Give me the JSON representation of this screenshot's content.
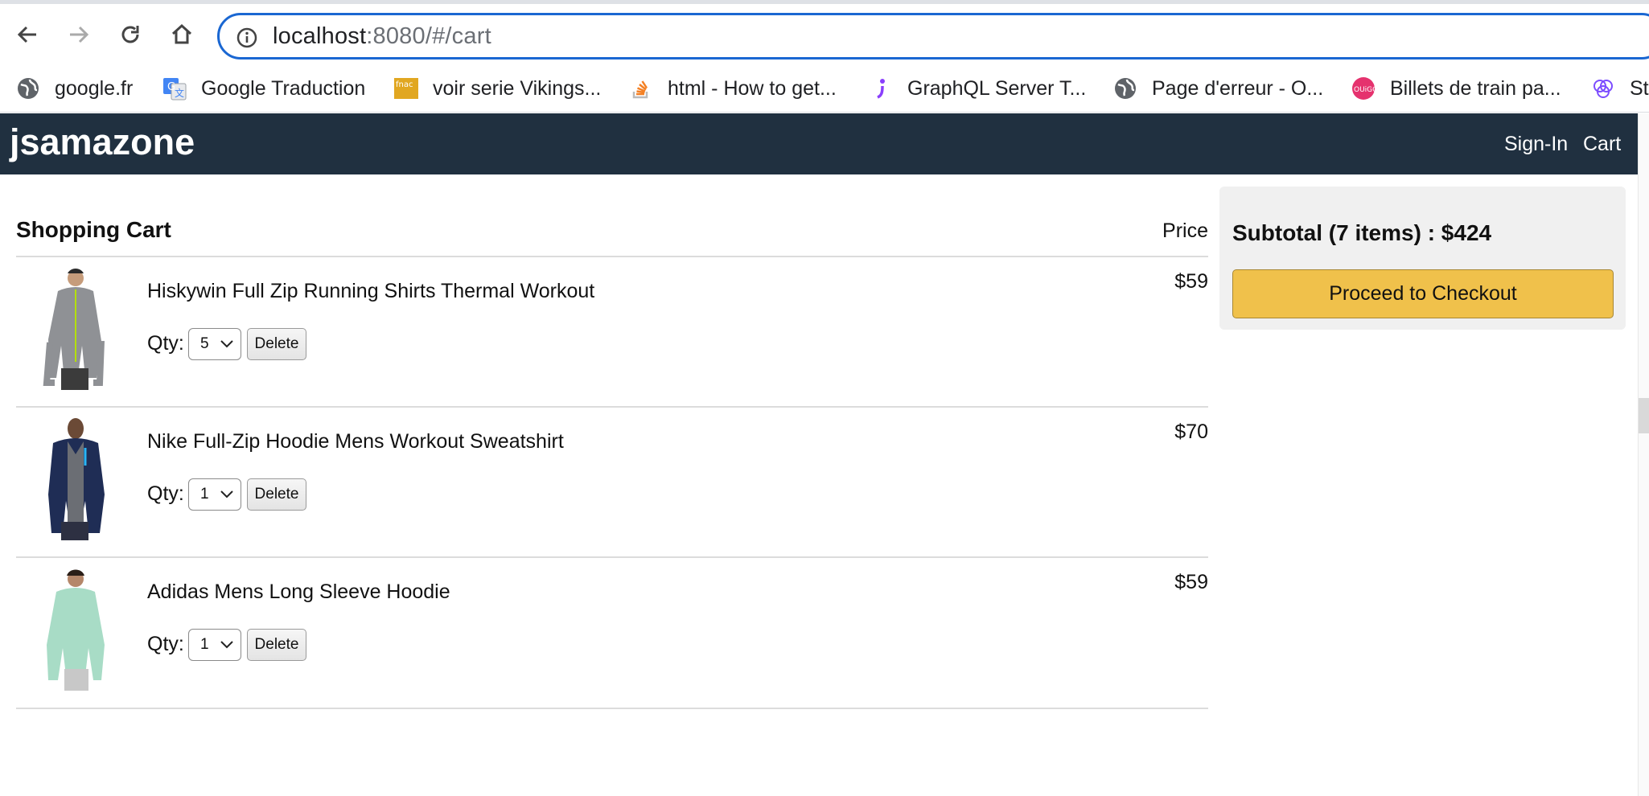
{
  "browser": {
    "url_host": "localhost",
    "url_rest": ":8080/#/cart",
    "bookmarks": [
      {
        "label": "google.fr",
        "icon": "globe-icon"
      },
      {
        "label": "Google Traduction",
        "icon": "google-translate-icon"
      },
      {
        "label": "voir serie Vikings...",
        "icon": "fnac-icon"
      },
      {
        "label": "html - How to get...",
        "icon": "stackoverflow-icon"
      },
      {
        "label": "GraphQL Server T...",
        "icon": "graphql-icon"
      },
      {
        "label": "Page d'erreur - O...",
        "icon": "globe-icon"
      },
      {
        "label": "Billets de train pa...",
        "icon": "ouigo-icon"
      },
      {
        "label": "St",
        "icon": "apollo-icon"
      }
    ]
  },
  "header": {
    "brand": "jsamazone",
    "signin": "Sign-In",
    "cart": "Cart",
    "bg_color": "#203040"
  },
  "cart": {
    "title": "Shopping Cart",
    "price_heading": "Price",
    "qty_label": "Qty:",
    "delete_label": "Delete",
    "items": [
      {
        "name": "Hiskywin Full Zip Running Shirts Thermal Workout",
        "qty": "5",
        "price": "$59"
      },
      {
        "name": "Nike Full-Zip Hoodie Mens Workout Sweatshirt",
        "qty": "1",
        "price": "$70"
      },
      {
        "name": "Adidas Mens Long Sleeve Hoodie",
        "qty": "1",
        "price": "$59"
      }
    ]
  },
  "summary": {
    "subtotal": "Subtotal (7 items) : $424",
    "checkout_label": "Proceed to Checkout",
    "button_color": "#f0c14b"
  }
}
